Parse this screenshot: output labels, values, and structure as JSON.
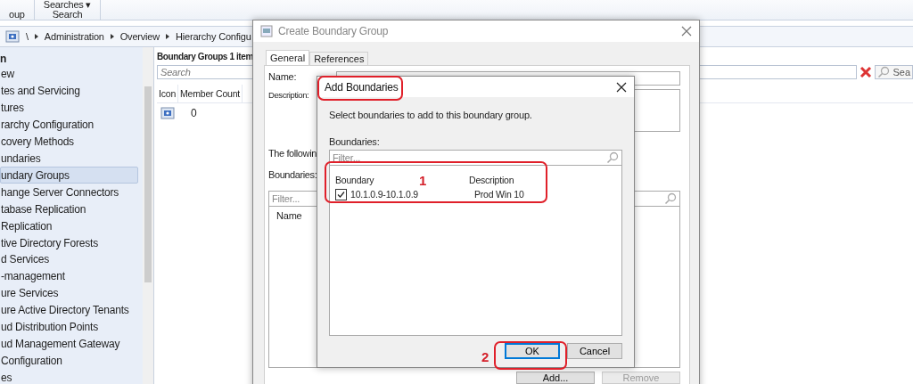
{
  "ribbon": {
    "groups": [
      {
        "label": "oup"
      },
      {
        "label": "Searches ▾",
        "caption": "Search"
      }
    ]
  },
  "breadcrumb": {
    "items": [
      "\\",
      "Administration",
      "Overview",
      "Hierarchy Configu"
    ]
  },
  "navigation": {
    "header": "n",
    "items": [
      {
        "label": "ew",
        "selected": false
      },
      {
        "label": "tes and Servicing",
        "selected": false
      },
      {
        "label": "tures",
        "selected": false
      },
      {
        "label": "rarchy Configuration",
        "selected": false
      },
      {
        "label": "covery Methods",
        "selected": false
      },
      {
        "label": "undaries",
        "selected": false
      },
      {
        "label": "undary Groups",
        "selected": true
      },
      {
        "label": "hange Server Connectors",
        "selected": false
      },
      {
        "label": "tabase Replication",
        "selected": false
      },
      {
        "label": " Replication",
        "selected": false
      },
      {
        "label": "tive Directory Forests",
        "selected": false
      },
      {
        "label": "d Services",
        "selected": false
      },
      {
        "label": "-management",
        "selected": false
      },
      {
        "label": "ure Services",
        "selected": false
      },
      {
        "label": "ure Active Directory Tenants",
        "selected": false
      },
      {
        "label": "ud Distribution Points",
        "selected": false
      },
      {
        "label": "ud Management Gateway",
        "selected": false
      },
      {
        "label": "Configuration",
        "selected": false
      },
      {
        "label": "es",
        "selected": false
      }
    ]
  },
  "results": {
    "title": "Boundary Groups 1 item",
    "search": {
      "placeholder": "Search"
    },
    "search_button": "Sea",
    "columns": [
      "Icon",
      "Member Count"
    ],
    "rows": [
      {
        "member_count": "0"
      }
    ]
  },
  "create_dialog": {
    "title": "Create Boundary Group",
    "tabs": [
      {
        "label": "General",
        "selected": true
      },
      {
        "label": "References",
        "selected": false
      }
    ],
    "name_label": "Name:",
    "description_label": "Description:",
    "following_text": "The followin",
    "boundaries_label": "Boundaries:",
    "filter": {
      "placeholder": "Filter..."
    },
    "list_column": "Name",
    "buttons": [
      {
        "label": "Add...",
        "disabled": false
      },
      {
        "label": "Remove",
        "disabled": true
      }
    ]
  },
  "add_dialog": {
    "title": "Add Boundaries",
    "instruction": "Select boundaries to add to this boundary group.",
    "boundaries_label": "Boundaries:",
    "filter": {
      "placeholder": "Filter..."
    },
    "columns": [
      "Boundary",
      "Description"
    ],
    "rows": [
      {
        "boundary": "10.1.0.9-10.1.0.9",
        "description": "Prod Win 10",
        "checked": true
      }
    ],
    "buttons": [
      {
        "label": "OK",
        "default": true
      },
      {
        "label": "Cancel",
        "default": false
      }
    ]
  },
  "annotations": [
    {
      "label": "1"
    },
    {
      "label": "2"
    }
  ]
}
